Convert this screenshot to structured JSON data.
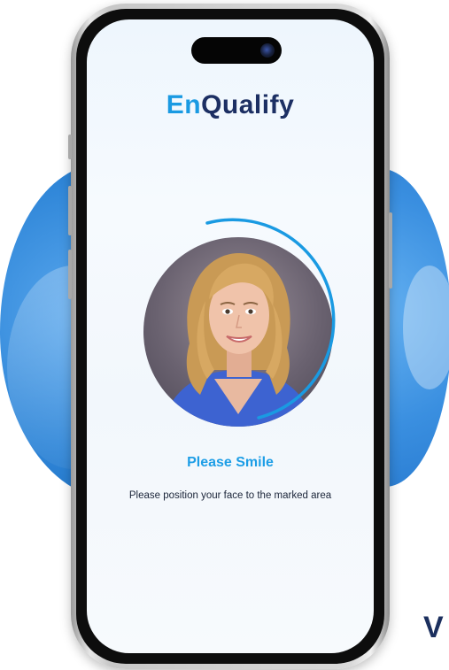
{
  "app": {
    "logo_part1": "En",
    "logo_part2": "Qualify",
    "brand_colors": {
      "primary_blue": "#1a9ae2",
      "navy": "#1c2f63"
    }
  },
  "liveness": {
    "title": "Please Smile",
    "instruction": "Please position your face to the marked area",
    "progress_icon": "circular-progress-arc",
    "photo_icon": "user-face-photo"
  },
  "background": {
    "partial_text": "V",
    "blob_color": "#2f86d8"
  }
}
